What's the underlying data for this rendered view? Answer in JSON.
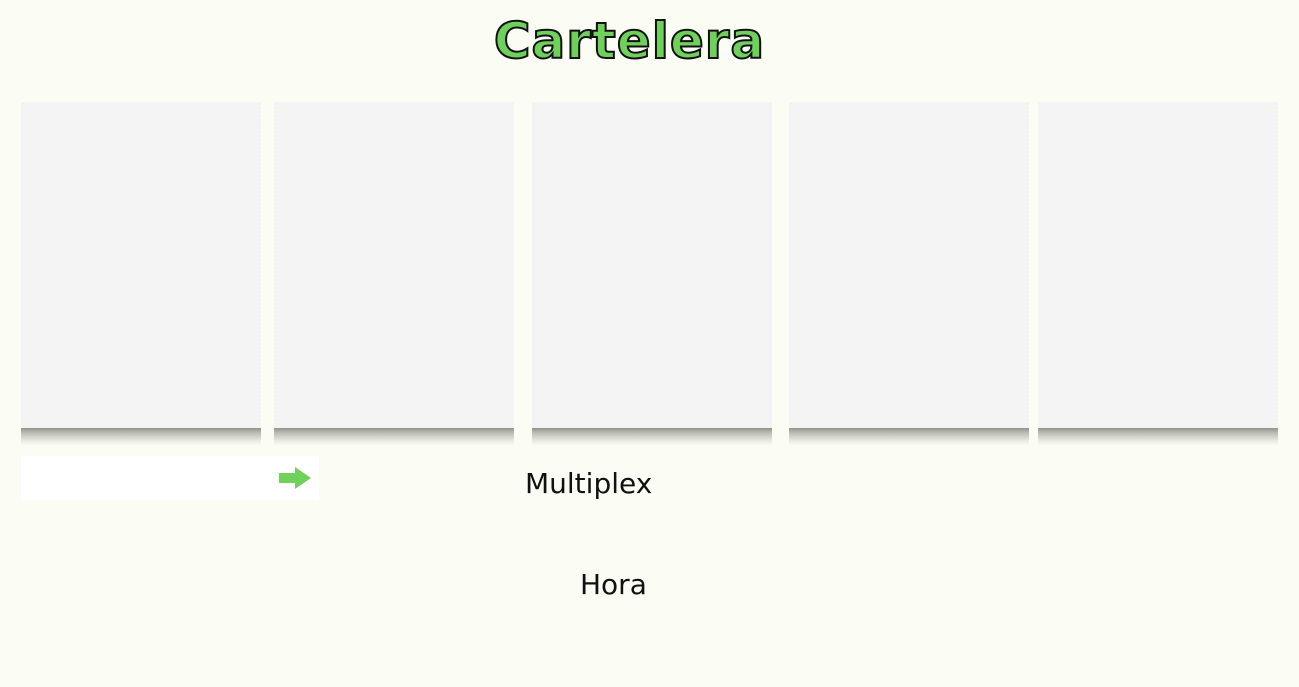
{
  "header": {
    "title": "Cartelera"
  },
  "posters": [
    {
      "id": "1"
    },
    {
      "id": "2"
    },
    {
      "id": "3"
    },
    {
      "id": "4"
    },
    {
      "id": "5"
    }
  ],
  "selector": {
    "value": "",
    "icon": "arrow-right-icon",
    "icon_color": "#6fd05c"
  },
  "labels": {
    "multiplex": "Multiplex",
    "hora": "Hora"
  },
  "colors": {
    "background": "#fbfcf4",
    "title_fill": "#6fd05c",
    "title_stroke": "#111111"
  }
}
